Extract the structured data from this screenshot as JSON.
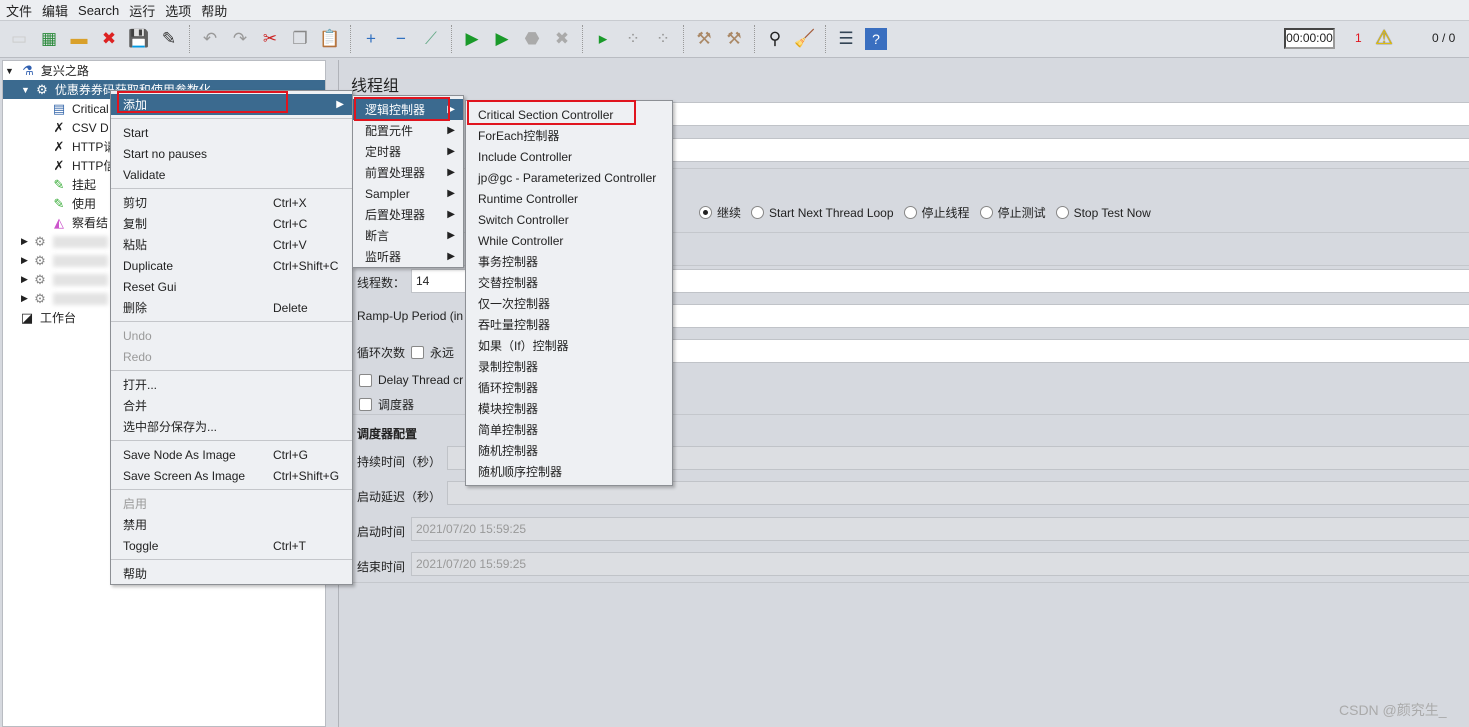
{
  "menubar": [
    "文件",
    "编辑",
    "Search",
    "运行",
    "选项",
    "帮助"
  ],
  "status": {
    "timer": "00:00:00",
    "warnings": "1",
    "threads": "0 / 0",
    "warning_color": "#e0141e"
  },
  "tree": {
    "root": "复兴之路",
    "selected": "优惠券券码获取和使用参数化",
    "children": [
      "Critical",
      "CSV D",
      "HTTP请",
      "HTTP信",
      "挂起",
      "使用",
      "察看结"
    ],
    "workbench": "工作台"
  },
  "panel": {
    "title": "线程组",
    "radios": [
      "继续",
      "Start Next Thread Loop",
      "停止线程",
      "停止测试",
      "Stop Test Now"
    ],
    "threads_label": "线程数：",
    "threads_value": "14",
    "rampup_label": "Ramp-Up Period (in",
    "loop_label": "循环次数",
    "forever_label": "永远",
    "delay_label": "Delay Thread cr",
    "scheduler_label": "调度器",
    "scheduler_config": "调度器配置",
    "duration_label": "持续时间（秒）",
    "startup_delay_label": "启动延迟（秒）",
    "start_time_label": "启动时间",
    "start_time": "2021/07/20 15:59:25",
    "end_time_label": "结束时间",
    "end_time": "2021/07/20 15:59:25"
  },
  "context_menu": [
    {
      "label": "添加",
      "arrow": true,
      "selected": true
    },
    {
      "sep": true
    },
    {
      "label": "Start"
    },
    {
      "label": "Start no pauses"
    },
    {
      "label": "Validate"
    },
    {
      "sep": true
    },
    {
      "label": "剪切",
      "shortcut": "Ctrl+X"
    },
    {
      "label": "复制",
      "shortcut": "Ctrl+C"
    },
    {
      "label": "粘贴",
      "shortcut": "Ctrl+V"
    },
    {
      "label": "Duplicate",
      "shortcut": "Ctrl+Shift+C"
    },
    {
      "label": "Reset Gui"
    },
    {
      "label": "删除",
      "shortcut": "Delete"
    },
    {
      "sep": true
    },
    {
      "label": "Undo",
      "disabled": true
    },
    {
      "label": "Redo",
      "disabled": true
    },
    {
      "sep": true
    },
    {
      "label": "打开..."
    },
    {
      "label": "合并"
    },
    {
      "label": "选中部分保存为..."
    },
    {
      "sep": true
    },
    {
      "label": "Save Node As Image",
      "shortcut": "Ctrl+G"
    },
    {
      "label": "Save Screen As Image",
      "shortcut": "Ctrl+Shift+G"
    },
    {
      "sep": true
    },
    {
      "label": "启用",
      "disabled": true
    },
    {
      "label": "禁用"
    },
    {
      "label": "Toggle",
      "shortcut": "Ctrl+T"
    },
    {
      "sep": true
    },
    {
      "label": "帮助"
    }
  ],
  "add_submenu": [
    {
      "label": "逻辑控制器",
      "arrow": true,
      "selected": true
    },
    {
      "label": "配置元件",
      "arrow": true
    },
    {
      "label": "定时器",
      "arrow": true
    },
    {
      "label": "前置处理器",
      "arrow": true
    },
    {
      "label": "Sampler",
      "arrow": true
    },
    {
      "label": "后置处理器",
      "arrow": true
    },
    {
      "label": "断言",
      "arrow": true
    },
    {
      "label": "监听器",
      "arrow": true
    }
  ],
  "logic_controllers": [
    {
      "label": "Critical Section Controller"
    },
    {
      "label": "ForEach控制器"
    },
    {
      "label": "Include Controller"
    },
    {
      "label": "jp@gc - Parameterized Controller"
    },
    {
      "label": "Runtime Controller"
    },
    {
      "label": "Switch Controller"
    },
    {
      "label": "While Controller"
    },
    {
      "label": "事务控制器"
    },
    {
      "label": "交替控制器"
    },
    {
      "label": "仅一次控制器"
    },
    {
      "label": "吞吐量控制器"
    },
    {
      "label": "如果（If）控制器"
    },
    {
      "label": "录制控制器"
    },
    {
      "label": "循环控制器"
    },
    {
      "label": "模块控制器"
    },
    {
      "label": "简单控制器"
    },
    {
      "label": "随机控制器"
    },
    {
      "label": "随机顺序控制器"
    }
  ],
  "watermark": "CSDN @颜究生_"
}
